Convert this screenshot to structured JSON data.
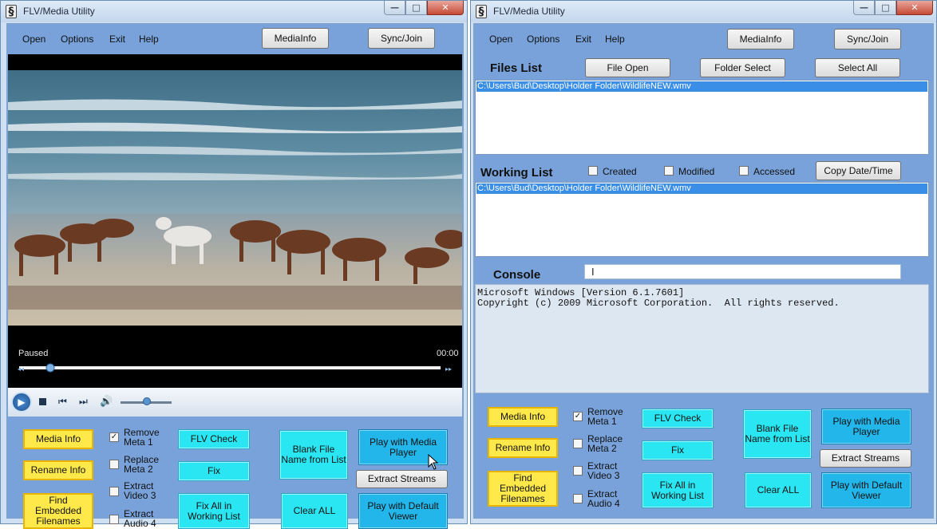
{
  "left": {
    "title": "FLV/Media Utility",
    "menu": [
      "Open",
      "Options",
      "Exit",
      "Help"
    ],
    "mediainfo_btn": "MediaInfo",
    "sync_btn": "Sync/Join",
    "player": {
      "status": "Paused",
      "time": "00:00"
    },
    "actions": {
      "media_info": "Media Info",
      "rename_info": "Rename Info",
      "find_embedded": "Find Embedded Filenames",
      "remove_meta": "Remove Meta  1",
      "replace_meta": "Replace Meta  2",
      "extract_video": "Extract Video 3",
      "extract_audio": "Extract Audio 4",
      "flv_check": "FLV Check",
      "fix": "Fix",
      "fix_all": "Fix All in Working List",
      "blank_file": "Blank File Name from List",
      "clear_all": "Clear ALL",
      "play_media_player": "Play with Media Player",
      "extract_streams": "Extract Streams",
      "play_default": "Play with Default Viewer"
    }
  },
  "right": {
    "title": "FLV/Media Utility",
    "menu": [
      "Open",
      "Options",
      "Exit",
      "Help"
    ],
    "mediainfo_btn": "MediaInfo",
    "sync_btn": "Sync/Join",
    "files_list_label": "Files List",
    "file_open": "File Open",
    "folder_select": "Folder Select",
    "select_all": "Select All",
    "files_list_items": [
      "C:\\Users\\Bud\\Desktop\\Holder Folder\\WildlifeNEW.wmv"
    ],
    "working_list_label": "Working List",
    "created": "Created",
    "modified": "Modified",
    "accessed": "Accessed",
    "copy_date": "Copy Date/Time",
    "working_list_items": [
      "C:\\Users\\Bud\\Desktop\\Holder Folder\\WildlifeNEW.wmv"
    ],
    "console_label": "Console",
    "console_input": "",
    "console_lines": [
      "Microsoft Windows [Version 6.1.7601]",
      "Copyright (c) 2009 Microsoft Corporation.  All rights reserved."
    ],
    "actions": {
      "media_info": "Media Info",
      "rename_info": "Rename Info",
      "find_embedded": "Find Embedded Filenames",
      "remove_meta": "Remove Meta  1",
      "replace_meta": "Replace Meta  2",
      "extract_video": "Extract Video 3",
      "extract_audio": "Extract Audio 4",
      "flv_check": "FLV Check",
      "fix": "Fix",
      "fix_all": "Fix All in Working List",
      "blank_file": "Blank File Name from List",
      "clear_all": "Clear ALL",
      "play_media_player": "Play with Media Player",
      "extract_streams": "Extract Streams",
      "play_default": "Play with Default Viewer"
    }
  },
  "checkbox_state": {
    "remove_meta": true,
    "replace_meta": false,
    "extract_video": false,
    "extract_audio": false
  },
  "colors": {
    "client_bg": "#78a2d9",
    "yellow_btn": "#ffe94a",
    "cyan_btn": "#29e6f2",
    "blue_btn": "#22b6ea",
    "selection": "#3a8ee6"
  },
  "icons": [
    "app-icon",
    "play-icon",
    "stop-icon",
    "previous-icon",
    "next-icon",
    "volume-icon",
    "cursor-icon"
  ]
}
